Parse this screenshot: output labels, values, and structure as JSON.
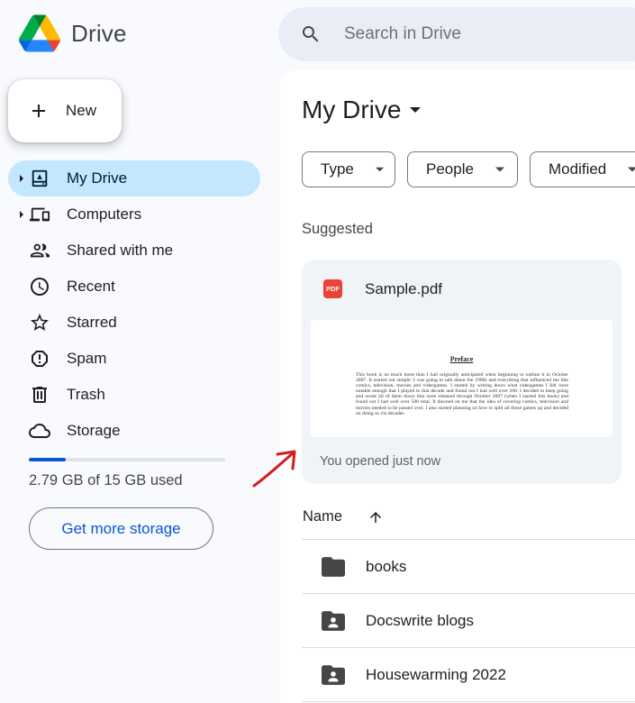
{
  "app": {
    "name": "Drive",
    "brand_colors": [
      "#4285f4",
      "#34a853",
      "#fbbc04",
      "#ea4335"
    ]
  },
  "search": {
    "placeholder": "Search in Drive"
  },
  "sidebar": {
    "new_label": "New",
    "items": [
      {
        "label": "My Drive",
        "icon": "my-drive-icon",
        "active": true,
        "expandable": true
      },
      {
        "label": "Computers",
        "icon": "computers-icon",
        "active": false,
        "expandable": true
      },
      {
        "label": "Shared with me",
        "icon": "shared-with-me-icon",
        "active": false,
        "expandable": false
      },
      {
        "label": "Recent",
        "icon": "clock-icon",
        "active": false,
        "expandable": false
      },
      {
        "label": "Starred",
        "icon": "star-icon",
        "active": false,
        "expandable": false
      },
      {
        "label": "Spam",
        "icon": "spam-icon",
        "active": false,
        "expandable": false
      },
      {
        "label": "Trash",
        "icon": "trash-icon",
        "active": false,
        "expandable": false
      },
      {
        "label": "Storage",
        "icon": "cloud-icon",
        "active": false,
        "expandable": false
      }
    ],
    "storage": {
      "used_text": "2.79 GB of 15 GB used",
      "used_fraction": 0.186,
      "cta": "Get more storage"
    }
  },
  "main": {
    "title": "My Drive",
    "filters": [
      "Type",
      "People",
      "Modified"
    ],
    "suggested_label": "Suggested",
    "suggested_card": {
      "file_type_badge": "PDF",
      "name": "Sample.pdf",
      "preview_title": "Preface",
      "preview_text": "This book is no much more than I had originally anticipated when beginning to outline it in October 2007. It started out simple: I was going to talk about the 1980s and everything that influenced me like comics, television, movies and videogames. I started by writing down what videogames I felt were notable enough that I played in that decade and found out I had well over 100. I decided to keep going and wrote all of them down that were released through October 2007 (when I started this book) and found out I had well over 500 total. It dawned on me that the idea of covering comics, television and movies needed to be passed over. I also started planning on how to split all those games up and decided on doing so via decades.",
      "footer": "You opened just now"
    },
    "list": {
      "column_name": "Name",
      "files": [
        {
          "name": "books",
          "icon": "folder-icon"
        },
        {
          "name": "Docswrite blogs",
          "icon": "shared-folder-icon"
        },
        {
          "name": "Housewarming 2022",
          "icon": "shared-folder-icon"
        }
      ]
    }
  },
  "annotation": {
    "color": "#d21e1e"
  }
}
